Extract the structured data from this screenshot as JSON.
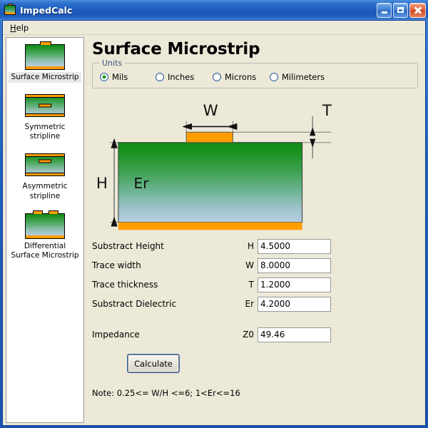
{
  "window": {
    "title": "ImpedCalc",
    "icon": "microstrip-icon",
    "buttons": {
      "minimize": "minimize-icon",
      "maximize": "maximize-icon",
      "close": "close-icon"
    },
    "accent_color": "#1e5fc2"
  },
  "menubar": {
    "items": [
      {
        "label": "Help",
        "mnemonic": "H"
      }
    ]
  },
  "sidebar": {
    "items": [
      {
        "label": "Surface Microstrip",
        "type": "surface-microstrip",
        "selected": true
      },
      {
        "label": "Symmetric stripline",
        "type": "symmetric-stripline",
        "selected": false
      },
      {
        "label": "Asymmetric stripline",
        "type": "asymmetric-stripline",
        "selected": false
      },
      {
        "label": "Differential Surface Microstrip",
        "type": "differential-surface-microstrip",
        "selected": false
      }
    ]
  },
  "main": {
    "title": "Surface Microstrip",
    "units": {
      "group_label": "Units",
      "options": [
        {
          "label": "Mils",
          "selected": true
        },
        {
          "label": "Inches",
          "selected": false
        },
        {
          "label": "Microns",
          "selected": false
        },
        {
          "label": "Milimeters",
          "selected": false
        }
      ]
    },
    "diagram": {
      "labels": {
        "width": "W",
        "thickness": "T",
        "height": "H",
        "dielectric": "Er"
      },
      "colors": {
        "trace": "#ff9c00",
        "ground": "#ff9c00",
        "substrate_top": "#0f8a14",
        "substrate_bottom": "#b9cde2"
      }
    },
    "fields": [
      {
        "name": "Substract Height",
        "symbol": "H",
        "value": "4.5000"
      },
      {
        "name": "Trace width",
        "symbol": "W",
        "value": "8.0000"
      },
      {
        "name": "Trace thickness",
        "symbol": "T",
        "value": "1.2000"
      },
      {
        "name": "Substract Dielectric",
        "symbol": "Er",
        "value": "4.2000"
      }
    ],
    "result": {
      "name": "Impedance",
      "symbol": "Z0",
      "value": "49.46"
    },
    "calculate_label": "Calculate",
    "note": "Note: 0.25<= W/H <=6; 1<Er<=16"
  }
}
